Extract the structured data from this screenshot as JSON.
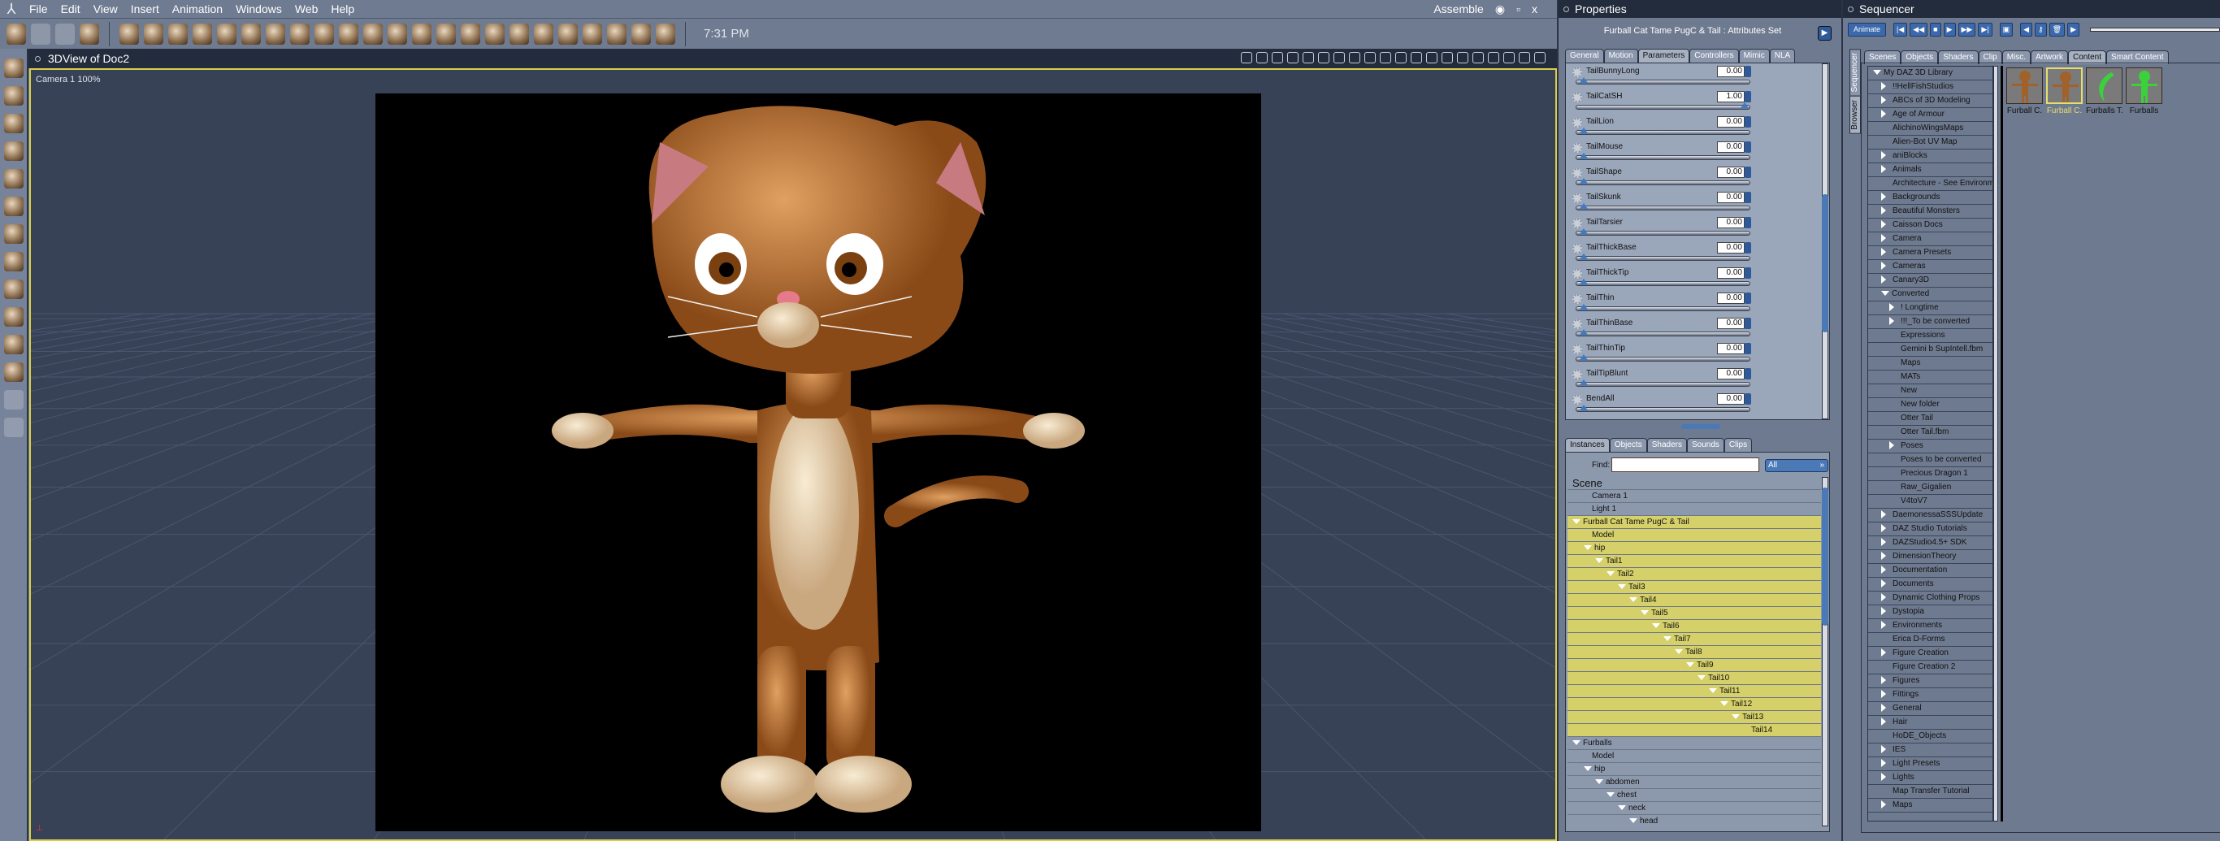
{
  "menubar": {
    "items": [
      "File",
      "Edit",
      "View",
      "Insert",
      "Animation",
      "Windows",
      "Web",
      "Help"
    ],
    "room": "Assemble",
    "clock": "7:31 PM"
  },
  "viewport": {
    "title": "3DView of Doc2",
    "camera_label": "Camera 1 100%"
  },
  "properties": {
    "title": "Properties",
    "attr_title": "Furball Cat Tame PugC & Tail : Attributes Set",
    "tabs": [
      "General",
      "Motion",
      "Parameters",
      "Controllers",
      "Mimic",
      "NLA"
    ],
    "active_tab": "Parameters",
    "params": [
      {
        "label": "TailBunnyLong",
        "value": "0.00",
        "fraction": 0
      },
      {
        "label": "TailCatSH",
        "value": "1.00",
        "fraction": 1
      },
      {
        "label": "TailLion",
        "value": "0.00",
        "fraction": 0
      },
      {
        "label": "TailMouse",
        "value": "0.00",
        "fraction": 0
      },
      {
        "label": "TailShape",
        "value": "0.00",
        "fraction": 0
      },
      {
        "label": "TailSkunk",
        "value": "0.00",
        "fraction": 0
      },
      {
        "label": "TailTarsier",
        "value": "0.00",
        "fraction": 0
      },
      {
        "label": "TailThickBase",
        "value": "0.00",
        "fraction": 0
      },
      {
        "label": "TailThickTip",
        "value": "0.00",
        "fraction": 0
      },
      {
        "label": "TailThin",
        "value": "0.00",
        "fraction": 0
      },
      {
        "label": "TailThinBase",
        "value": "0.00",
        "fraction": 0
      },
      {
        "label": "TailThinTip",
        "value": "0.00",
        "fraction": 0
      },
      {
        "label": "TailTipBlunt",
        "value": "0.00",
        "fraction": 0
      },
      {
        "label": "BendAll",
        "value": "0.00",
        "fraction": 0
      }
    ],
    "inst_tabs": [
      "Instances",
      "Objects",
      "Shaders",
      "Sounds",
      "Clips"
    ],
    "find_label": "Find:",
    "find_value": "",
    "filter": "All",
    "tree": [
      {
        "label": "Scene",
        "depth": 0,
        "type": "scene"
      },
      {
        "label": "Camera 1",
        "depth": 1
      },
      {
        "label": "Light 1",
        "depth": 1
      },
      {
        "label": "Furball Cat Tame PugC & Tail",
        "depth": 0,
        "expand": true,
        "sel": true
      },
      {
        "label": "Model",
        "depth": 1,
        "sel": true
      },
      {
        "label": "hip",
        "depth": 1,
        "expand": true,
        "sel": true
      },
      {
        "label": "Tail1",
        "depth": 2,
        "expand": true,
        "sel": true
      },
      {
        "label": "Tail2",
        "depth": 3,
        "expand": true,
        "sel": true
      },
      {
        "label": "Tail3",
        "depth": 4,
        "expand": true,
        "sel": true
      },
      {
        "label": "Tail4",
        "depth": 5,
        "expand": true,
        "sel": true
      },
      {
        "label": "Tail5",
        "depth": 6,
        "expand": true,
        "sel": true
      },
      {
        "label": "Tail6",
        "depth": 7,
        "expand": true,
        "sel": true
      },
      {
        "label": "Tail7",
        "depth": 8,
        "expand": true,
        "sel": true
      },
      {
        "label": "Tail8",
        "depth": 9,
        "expand": true,
        "sel": true
      },
      {
        "label": "Tail9",
        "depth": 10,
        "expand": true,
        "sel": true
      },
      {
        "label": "Tail10",
        "depth": 11,
        "expand": true,
        "sel": true
      },
      {
        "label": "Tail11",
        "depth": 12,
        "expand": true,
        "sel": true
      },
      {
        "label": "Tail12",
        "depth": 13,
        "expand": true,
        "sel": true
      },
      {
        "label": "Tail13",
        "depth": 14,
        "expand": true,
        "sel": true
      },
      {
        "label": "Tail14",
        "depth": 15,
        "sel": true
      },
      {
        "label": "Furballs",
        "depth": 0,
        "expand": true
      },
      {
        "label": "Model",
        "depth": 1
      },
      {
        "label": "hip",
        "depth": 1,
        "expand": true
      },
      {
        "label": "abdomen",
        "depth": 2,
        "expand": true
      },
      {
        "label": "chest",
        "depth": 3,
        "expand": true
      },
      {
        "label": "neck",
        "depth": 4,
        "expand": true
      },
      {
        "label": "head",
        "depth": 5,
        "expand": true
      }
    ]
  },
  "sequencer": {
    "title": "Sequencer",
    "animate_label": "Animate",
    "side_tabs": [
      "Sequencer",
      "Browser"
    ],
    "tabs": [
      "Scenes",
      "Objects",
      "Shaders",
      "Clip",
      "Misc.",
      "Artwork",
      "Content",
      "Smart Content"
    ],
    "active_tab": "Content",
    "library": [
      {
        "label": "My DAZ 3D Library",
        "depth": 0,
        "state": "open"
      },
      {
        "label": "!!HellFishStudios",
        "depth": 1,
        "state": "closed"
      },
      {
        "label": "ABCs of 3D Modeling",
        "depth": 1,
        "state": "closed"
      },
      {
        "label": "Age of Armour",
        "depth": 1,
        "state": "closed"
      },
      {
        "label": "AlichinoWingsMaps",
        "depth": 1
      },
      {
        "label": "Alien-Bot UV Map",
        "depth": 1
      },
      {
        "label": "aniBlocks",
        "depth": 1,
        "state": "closed"
      },
      {
        "label": "Animals",
        "depth": 1,
        "state": "closed"
      },
      {
        "label": "Architecture - See Environments",
        "depth": 1
      },
      {
        "label": "Backgrounds",
        "depth": 1,
        "state": "closed"
      },
      {
        "label": "Beautiful Monsters",
        "depth": 1,
        "state": "closed"
      },
      {
        "label": "Caisson Docs",
        "depth": 1,
        "state": "closed"
      },
      {
        "label": "Camera",
        "depth": 1,
        "state": "closed"
      },
      {
        "label": "Camera Presets",
        "depth": 1,
        "state": "closed"
      },
      {
        "label": "Cameras",
        "depth": 1,
        "state": "closed"
      },
      {
        "label": "Canary3D",
        "depth": 1,
        "state": "closed"
      },
      {
        "label": "Converted",
        "depth": 1,
        "state": "open"
      },
      {
        "label": "! Longtime",
        "depth": 2,
        "state": "closed"
      },
      {
        "label": "!!!_To be converted",
        "depth": 2,
        "state": "closed"
      },
      {
        "label": "Expressions",
        "depth": 2
      },
      {
        "label": "Gemini b SupIntell.fbm",
        "depth": 2
      },
      {
        "label": "Maps",
        "depth": 2
      },
      {
        "label": "MATs",
        "depth": 2
      },
      {
        "label": "New",
        "depth": 2
      },
      {
        "label": "New folder",
        "depth": 2
      },
      {
        "label": "Otter Tail",
        "depth": 2
      },
      {
        "label": "Otter Tail.fbm",
        "depth": 2
      },
      {
        "label": "Poses",
        "depth": 2,
        "state": "closed"
      },
      {
        "label": "Poses to be converted",
        "depth": 2
      },
      {
        "label": "Precious Dragon 1",
        "depth": 2
      },
      {
        "label": "Raw_Gigalien",
        "depth": 2
      },
      {
        "label": "V4toV7",
        "depth": 2
      },
      {
        "label": "DaemonessaSSSUpdate",
        "depth": 1,
        "state": "closed"
      },
      {
        "label": "DAZ Studio Tutorials",
        "depth": 1,
        "state": "closed"
      },
      {
        "label": "DAZStudio4.5+ SDK",
        "depth": 1,
        "state": "closed"
      },
      {
        "label": "DimensionTheory",
        "depth": 1,
        "state": "closed"
      },
      {
        "label": "Documentation",
        "depth": 1,
        "state": "closed"
      },
      {
        "label": "Documents",
        "depth": 1,
        "state": "closed"
      },
      {
        "label": "Dynamic Clothing Props",
        "depth": 1,
        "state": "closed"
      },
      {
        "label": "Dystopia",
        "depth": 1,
        "state": "closed"
      },
      {
        "label": "Environments",
        "depth": 1,
        "state": "closed"
      },
      {
        "label": "Erica D-Forms",
        "depth": 1
      },
      {
        "label": "Figure Creation",
        "depth": 1,
        "state": "closed"
      },
      {
        "label": "Figure Creation 2",
        "depth": 1
      },
      {
        "label": "Figures",
        "depth": 1,
        "state": "closed"
      },
      {
        "label": "Fittings",
        "depth": 1,
        "state": "closed"
      },
      {
        "label": "General",
        "depth": 1,
        "state": "closed"
      },
      {
        "label": "Hair",
        "depth": 1,
        "state": "closed"
      },
      {
        "label": "HoDE_Objects",
        "depth": 1
      },
      {
        "label": "IES",
        "depth": 1,
        "state": "closed"
      },
      {
        "label": "Light Presets",
        "depth": 1,
        "state": "closed"
      },
      {
        "label": "Lights",
        "depth": 1,
        "state": "closed"
      },
      {
        "label": "Map Transfer Tutorial",
        "depth": 1
      },
      {
        "label": "Maps",
        "depth": 1,
        "state": "closed"
      }
    ],
    "thumbnails": [
      {
        "label": "Furball C.",
        "kind": "cat"
      },
      {
        "label": "Furball C.",
        "kind": "cat",
        "sel": true
      },
      {
        "label": "Furballs T.",
        "kind": "tail"
      },
      {
        "label": "Furballs",
        "kind": "green"
      }
    ]
  },
  "colors": {
    "accent_yellow": "#d6d06a",
    "button_blue": "#3c69ab",
    "panel": "#6e7a8f",
    "header": "#222c3d"
  }
}
